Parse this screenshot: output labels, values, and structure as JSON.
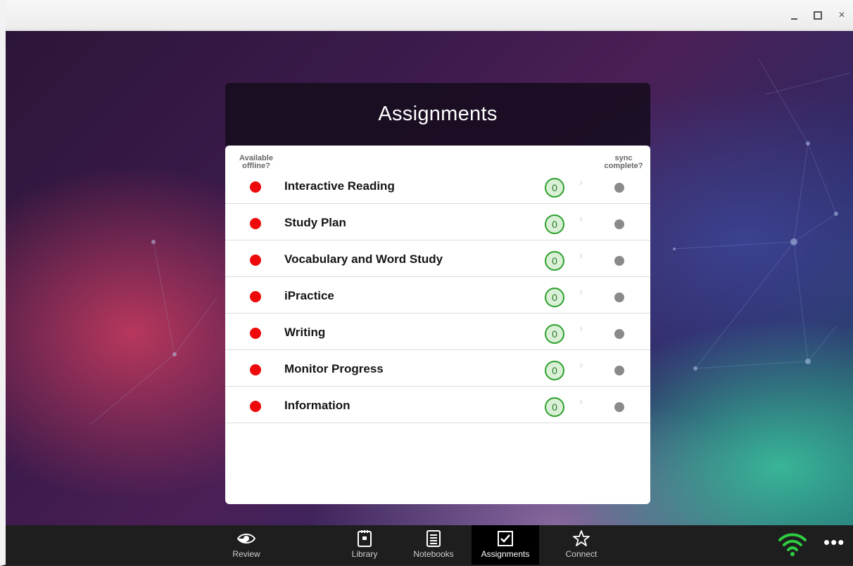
{
  "window": {
    "controls": [
      "minimize",
      "maximize",
      "close"
    ],
    "close_glyph": "×"
  },
  "panel": {
    "title": "Assignments",
    "col_left_header_line1": "Available",
    "col_left_header_line2": "offline?",
    "col_right_header_line1": "sync",
    "col_right_header_line2": "complete?",
    "rows": [
      {
        "label": "Interactive Reading",
        "count": "0",
        "offline_status_color": "#ee0a0a",
        "sync_status_color": "#8a8a8a"
      },
      {
        "label": "Study Plan",
        "count": "0",
        "offline_status_color": "#ee0a0a",
        "sync_status_color": "#8a8a8a"
      },
      {
        "label": "Vocabulary and Word Study",
        "count": "0",
        "offline_status_color": "#ee0a0a",
        "sync_status_color": "#8a8a8a"
      },
      {
        "label": "iPractice",
        "count": "0",
        "offline_status_color": "#ee0a0a",
        "sync_status_color": "#8a8a8a"
      },
      {
        "label": "Writing",
        "count": "0",
        "offline_status_color": "#ee0a0a",
        "sync_status_color": "#8a8a8a"
      },
      {
        "label": "Monitor Progress",
        "count": "0",
        "offline_status_color": "#ee0a0a",
        "sync_status_color": "#8a8a8a"
      },
      {
        "label": "Information",
        "count": "0",
        "offline_status_color": "#ee0a0a",
        "sync_status_color": "#8a8a8a"
      }
    ],
    "chevron_glyph": "›"
  },
  "bottom_nav": {
    "tabs": [
      {
        "label": "Review",
        "icon": "eye-icon"
      },
      {
        "label": "Library",
        "icon": "library-book-icon"
      },
      {
        "label": "Notebooks",
        "icon": "notebook-icon"
      },
      {
        "label": "Assignments",
        "icon": "checkbox-icon",
        "active": true
      },
      {
        "label": "Connect",
        "icon": "star-icon"
      }
    ],
    "wifi_icon": "wifi-icon",
    "wifi_color": "#2ecc40",
    "more_glyph": "•••"
  }
}
